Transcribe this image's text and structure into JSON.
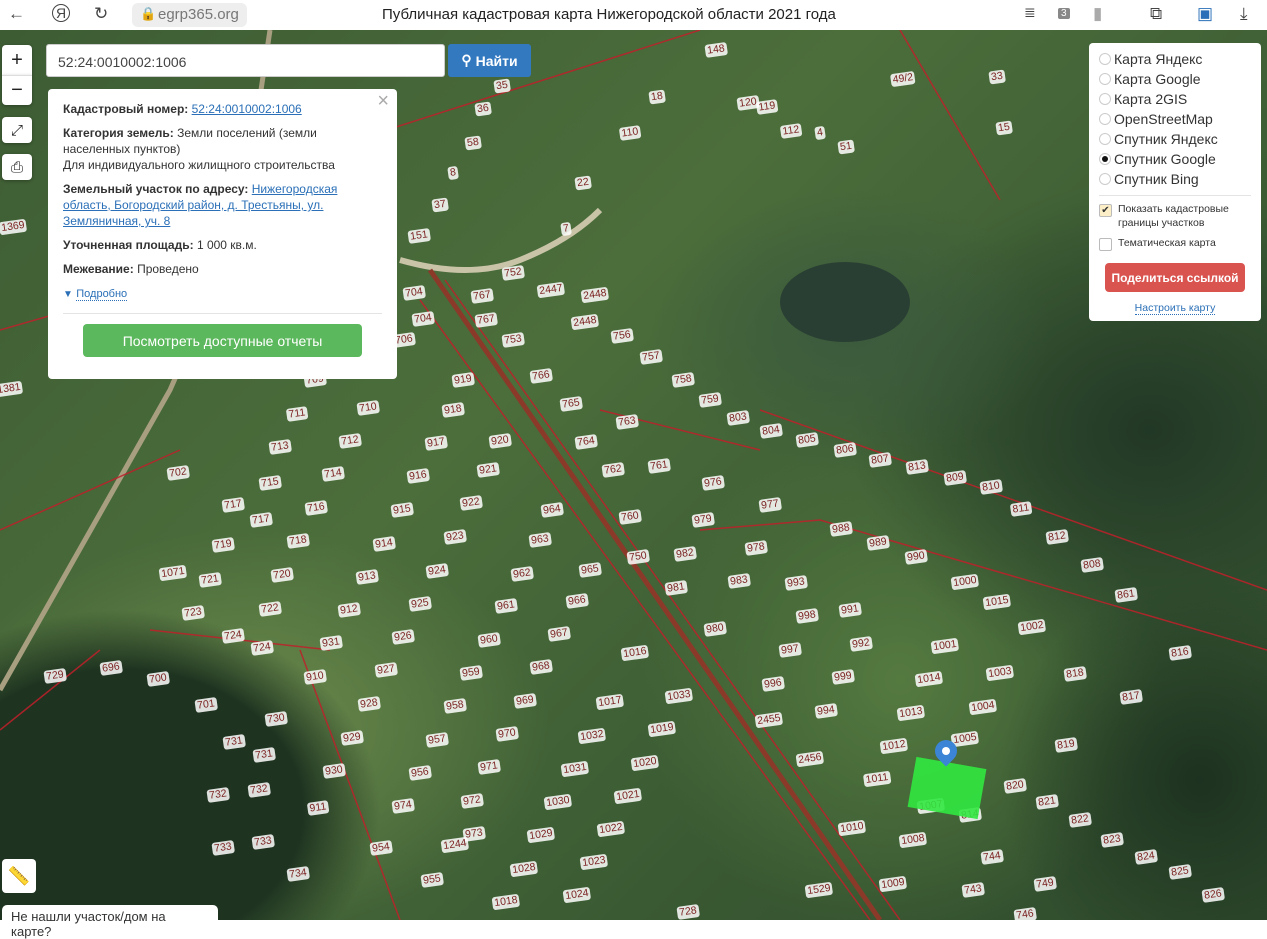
{
  "browser": {
    "back": "←",
    "yandex": "Я",
    "reload": "↻",
    "url": "egrp365.org",
    "title": "Публичная кадастровая карта Нижегородской области 2021 года",
    "tab_count": "3"
  },
  "search": {
    "value": "52:24:0010002:1006",
    "button": "Найти"
  },
  "info": {
    "cad_label": "Кадастровый номер:",
    "cad_value": "52:24:0010002:1006",
    "cat_label": "Категория земель:",
    "cat_value": "Земли поселений (земли населенных пунктов)",
    "use": "Для индивидуального жилищного строительства",
    "addr_label": "Земельный участок по адресу:",
    "addr_value": "Нижегородская область, Богородский район, д. Трестьяны, ул. Земляничная, уч. 8",
    "area_label": "Уточненная площадь:",
    "area_value": "1 000 кв.м.",
    "survey_label": "Межевание:",
    "survey_value": "Проведено",
    "more": "Подробно",
    "reports": "Посмотреть доступные отчеты",
    "close": "×"
  },
  "layers": {
    "options": [
      "Карта Яндекс",
      "Карта Google",
      "Карта 2GIS",
      "OpenStreetMap",
      "Спутник Яндекс",
      "Спутник Google",
      "Спутник Bing"
    ],
    "selected": 5,
    "show_borders": "Показать кадастровые границы участков",
    "show_borders_checked": true,
    "thematic": "Тематическая карта",
    "thematic_checked": false,
    "share": "Поделиться ссылкой",
    "configure": "Настроить карту"
  },
  "zoom": {
    "in": "+",
    "out": "−"
  },
  "not_found": "Не нашли участок/дом на карте?",
  "parcels": [
    "35",
    "36",
    "58",
    "8",
    "37",
    "151",
    "18",
    "110",
    "22",
    "7",
    "148",
    "120",
    "119",
    "112",
    "4",
    "51",
    "49/2",
    "33",
    "15",
    "752",
    "767",
    "767",
    "704",
    "704",
    "706",
    "753",
    "2447",
    "2448",
    "2448",
    "756",
    "757",
    "758",
    "759",
    "803",
    "766",
    "765",
    "763",
    "764",
    "762",
    "761",
    "919",
    "918",
    "917",
    "920",
    "921",
    "922",
    "923",
    "924",
    "925",
    "926",
    "927",
    "928",
    "929",
    "930",
    "911",
    "710",
    "709",
    "711",
    "712",
    "713",
    "714",
    "715",
    "716",
    "717",
    "717",
    "718",
    "719",
    "720",
    "721",
    "722",
    "723",
    "724",
    "724",
    "702",
    "1071",
    "729",
    "696",
    "700",
    "701",
    "730",
    "731",
    "731",
    "732",
    "732",
    "733",
    "733",
    "734",
    "916",
    "915",
    "914",
    "913",
    "912",
    "931",
    "910",
    "964",
    "963",
    "962",
    "961",
    "960",
    "959",
    "958",
    "957",
    "956",
    "974",
    "954",
    "955",
    "973",
    "972",
    "971",
    "970",
    "969",
    "968",
    "967",
    "966",
    "965",
    "760",
    "750",
    "981",
    "976",
    "977",
    "979",
    "978",
    "982",
    "983",
    "980",
    "1016",
    "1033",
    "1017",
    "1032",
    "1031",
    "1030",
    "1029",
    "1028",
    "1018",
    "1019",
    "1020",
    "1021",
    "1022",
    "1023",
    "1024",
    "728",
    "804",
    "805",
    "806",
    "807",
    "813",
    "809",
    "810",
    "811",
    "812",
    "808",
    "861",
    "816",
    "817",
    "818",
    "819",
    "820",
    "821",
    "822",
    "823",
    "824",
    "825",
    "826",
    "988",
    "989",
    "990",
    "1000",
    "1015",
    "1002",
    "993",
    "991",
    "998",
    "992",
    "997",
    "999",
    "996",
    "994",
    "1001",
    "1003",
    "1014",
    "1004",
    "1013",
    "1012",
    "1005",
    "1011",
    "1007",
    "814",
    "1010",
    "1008",
    "744",
    "1009",
    "743",
    "749",
    "746",
    "1529",
    "2456",
    "2455",
    "1369",
    "1381",
    "1244"
  ]
}
